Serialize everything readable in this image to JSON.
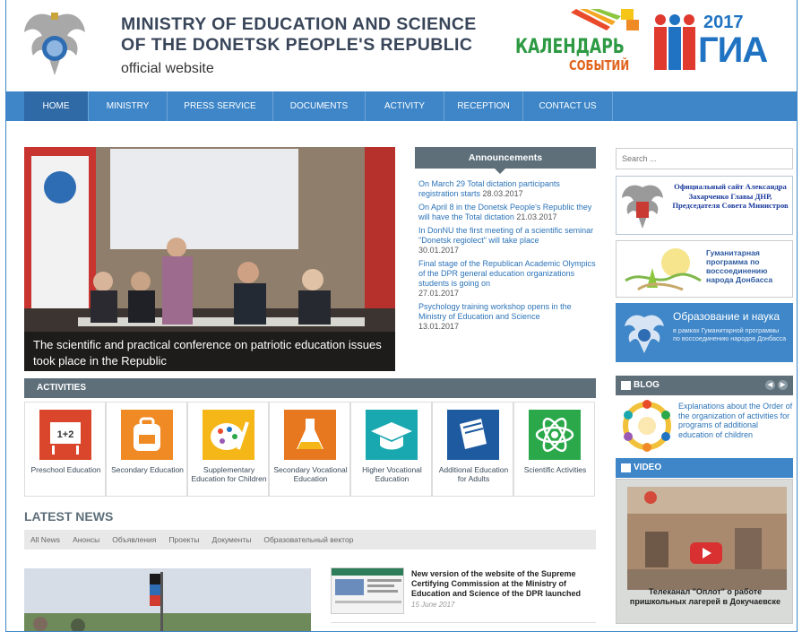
{
  "header": {
    "title_line1": "MINISTRY OF EDUCATION AND SCIENCE",
    "title_line2": "OF THE DONETSK PEOPLE'S REPUBLIC",
    "subtitle": "official website",
    "calendar_line1": "КАЛЕНДАРЬ",
    "calendar_line2": "СОБЫТИЙ",
    "gia_year": "2017",
    "gia_word": "ГИА"
  },
  "nav": [
    "HOME",
    "MINISTRY",
    "PRESS SERVICE",
    "DOCUMENTS",
    "ACTIVITY",
    "RECEPTION",
    "CONTACT US"
  ],
  "slider": {
    "caption": "The scientific and practical conference on patriotic education issues took place in the Republic"
  },
  "announcements": {
    "heading": "Announcements",
    "items": [
      {
        "text": "On March 29 Total dictation participants registration starts",
        "date": "28.03.2017"
      },
      {
        "text": "On April 8 in the Donetsk People's Republic they will have the Total dictation",
        "date": "21.03.2017"
      },
      {
        "text": "In DonNU the first meeting of a scientific seminar \"Donetsk regiolect\" will take place",
        "date": "30.01.2017"
      },
      {
        "text": "Final stage of the Republican Academic Olympics of the DPR general education organizations students is going on",
        "date": "27.01.2017"
      },
      {
        "text": "Psychology training workshop opens in the Ministry of Education and Science",
        "date": "13.01.2017"
      }
    ]
  },
  "search": {
    "placeholder": "Search ..."
  },
  "banners": {
    "b1": "Официальный сайт Александра Захарченко Главы ДНР, Председателя Совета Министров",
    "b2": "Гуманитарная программа по воссоединению народа Донбасса",
    "b3_title": "Образование и наука",
    "b3_sub": "в рамках Гуманитарной программы по воссоединению народов Донбасса"
  },
  "blog": {
    "heading": "BLOG",
    "item": "Explanations about the Order of the organization of activities for programs of additional education of children"
  },
  "video": {
    "heading": "VIDEO",
    "title": "Телеканал \"Оплот\" о работе пришкольных лагерей в Докучаевске"
  },
  "activities": {
    "heading": "ACTIVITIES",
    "items": [
      {
        "label": "Preschool Education",
        "color": "#d9462b",
        "icon": "one-plus-two-icon"
      },
      {
        "label": "Secondary Education",
        "color": "#f08a24",
        "icon": "backpack-icon"
      },
      {
        "label": "Supplementary Education for Children",
        "color": "#f5b617",
        "icon": "palette-icon"
      },
      {
        "label": "Secondary Vocational Education",
        "color": "#e8781f",
        "icon": "flask-icon"
      },
      {
        "label": "Higher Vocational Education",
        "color": "#19a8b0",
        "icon": "graduation-cap-icon"
      },
      {
        "label": "Additional Education for Adults",
        "color": "#1d5aa0",
        "icon": "book-icon"
      },
      {
        "label": "Scientific Activities",
        "color": "#2aa84a",
        "icon": "atom-icon"
      }
    ]
  },
  "latest_news": {
    "heading": "LATEST NEWS",
    "tabs": [
      "All News",
      "Анонсы",
      "Объявления",
      "Проекты",
      "Документы",
      "Образовательный вектор"
    ],
    "item_title": "New version of the website of the Supreme Certifying Commission at the Ministry of Education and Science of the DPR launched",
    "item_date": "15 June 2017"
  }
}
